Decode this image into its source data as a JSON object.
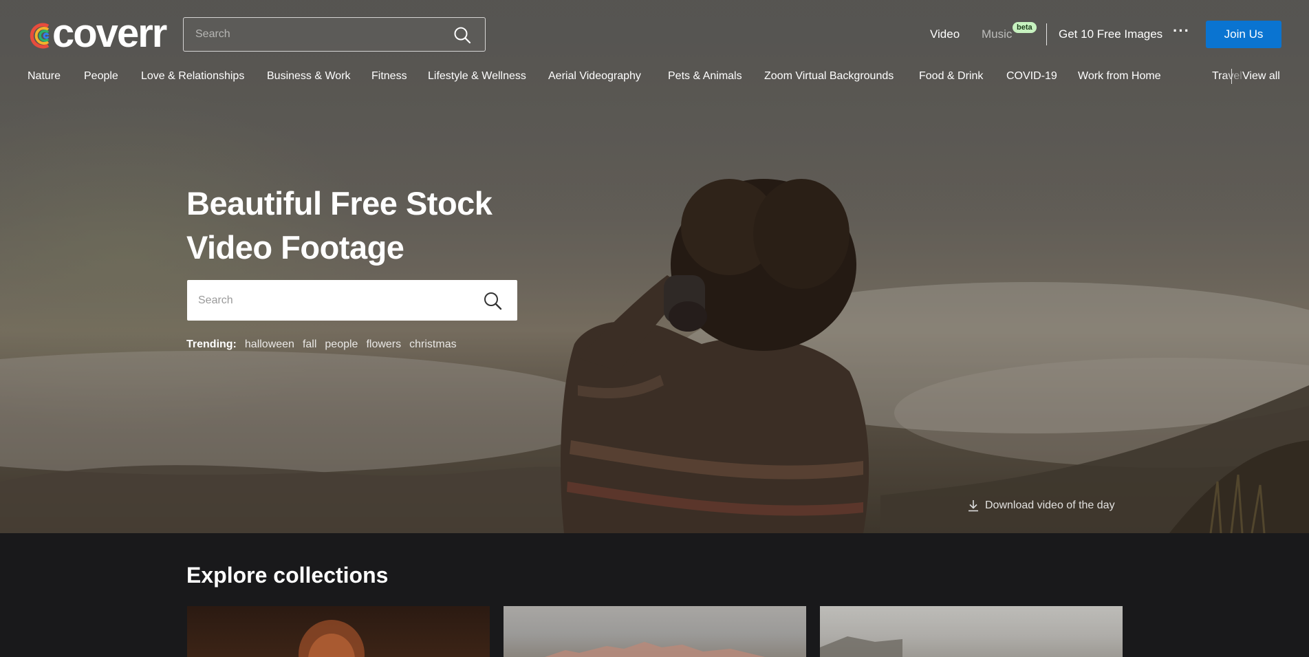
{
  "brand": {
    "name": "coverr"
  },
  "header": {
    "search_placeholder": "Search",
    "nav": {
      "video": "Video",
      "music": "Music",
      "music_badge": "beta",
      "free_images": "Get 10 Free Images",
      "more": "···",
      "join": "Join Us"
    }
  },
  "categories": {
    "items": [
      "Nature",
      "People",
      "Love & Relationships",
      "Business & Work",
      "Fitness",
      "Lifestyle & Wellness",
      "Aerial Videography",
      "Pets & Animals",
      "Zoom Virtual Backgrounds",
      "Food & Drink",
      "COVID-19",
      "Work from Home"
    ],
    "truncated": "Travel & Leisure",
    "view_all": "View all"
  },
  "hero": {
    "title_line1": "Beautiful Free Stock",
    "title_line2": "Video Footage",
    "search_placeholder": "Search",
    "trending_label": "Trending:",
    "trending": [
      "halloween",
      "fall",
      "people",
      "flowers",
      "christmas"
    ],
    "download_label": "Download video of the day"
  },
  "explore": {
    "title": "Explore collections"
  },
  "colors": {
    "accent": "#0a74d1",
    "beta_badge": "#c7f2c0",
    "page_bg": "#19191b"
  },
  "icons": {
    "search": "search-icon",
    "download": "download-icon",
    "more": "more-icon"
  }
}
